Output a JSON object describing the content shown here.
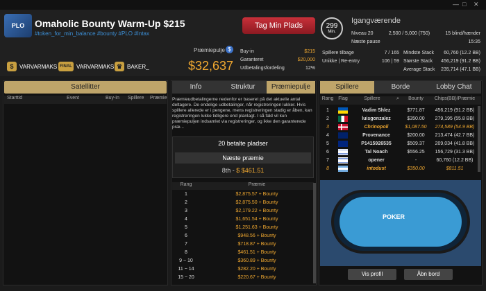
{
  "header": {
    "title": "Omaholic Bounty Warm-Up $215",
    "tags": "#token_for_min_balance #bounty #PLO #Intax",
    "bounties": [
      {
        "badge": "$",
        "name": "VARVARMAKS"
      },
      {
        "badge": "FINAL",
        "name": "VARVARMAKS"
      },
      {
        "badge": "trophy",
        "name": "BAKER_"
      }
    ]
  },
  "prize": {
    "label": "Præmiepulje",
    "value": "$32,637"
  },
  "buyin": [
    {
      "label": "Buy-in",
      "value": "$215"
    },
    {
      "label": "Garanteret",
      "value": "$20,000"
    },
    {
      "label": "Udbetalingsfordeling",
      "value": "12%"
    }
  ],
  "register_button": "Tag Min Plads",
  "clock": {
    "time": "299",
    "unit": "Min."
  },
  "status": "Igangværende",
  "level": [
    {
      "label": "Niveau 20",
      "value": "2,500 / 5,000 (750)",
      "extra": "15 blind/hænder"
    },
    {
      "label": "Næste pause",
      "value": "",
      "extra": "15:35"
    }
  ],
  "stats_left": [
    {
      "label": "Spillere tilbage",
      "value": "7 / 165"
    },
    {
      "label": "Unikke | Re-entry",
      "value": "106 | 59"
    }
  ],
  "stats_right": [
    {
      "label": "Mindste Stack",
      "value": "60,760 (12.2 BB)"
    },
    {
      "label": "Største Stack",
      "value": "456,219 (91.2 BB)"
    },
    {
      "label": "Average Stack",
      "value": "235,714 (47.1 BB)"
    }
  ],
  "satellites": {
    "button": "Satellitter",
    "columns": [
      "Starttid",
      "Event",
      "Buy-in",
      "Spillere",
      "Præmie"
    ]
  },
  "middle_tabs": [
    "Info",
    "Struktur",
    "Præmiepulje"
  ],
  "description": "Præmieudbetalingerne nedenfor er baseret på det aktuelle antal deltagere. De endelige udbetalinger, når registreringen lukker. Hvis spillere allerede er i pengene, mens registreringen stadig er åben, kan registreringen lukke tidligere end planlagt. I så fald vil kun præmiepuljen indsamlet via registreringer, og ikke den garanterede præ...",
  "paid_places": "20 betalte pladser",
  "next_prize": {
    "label": "Næste præmie",
    "place": "8th",
    "value": "$461.51"
  },
  "prize_columns": [
    "Rang",
    "Præmie"
  ],
  "prizes": [
    {
      "rank": "1",
      "prize": "$2,875.57 + Bounty"
    },
    {
      "rank": "2",
      "prize": "$2,875.50 + Bounty"
    },
    {
      "rank": "3",
      "prize": "$2,179.22 + Bounty"
    },
    {
      "rank": "4",
      "prize": "$1,651.54 + Bounty"
    },
    {
      "rank": "5",
      "prize": "$1,251.63 + Bounty"
    },
    {
      "rank": "6",
      "prize": "$948.56 + Bounty"
    },
    {
      "rank": "7",
      "prize": "$718.87 + Bounty"
    },
    {
      "rank": "8",
      "prize": "$461.51 + Bounty"
    },
    {
      "rank": "9 ~ 10",
      "prize": "$360.89 + Bounty"
    },
    {
      "rank": "11 ~ 14",
      "prize": "$282.20 + Bounty"
    },
    {
      "rank": "15 ~ 20",
      "prize": "$220.67 + Bounty"
    }
  ],
  "player_tabs": [
    "Spillere",
    "Borde",
    "Lobby Chat"
  ],
  "player_columns": [
    "Rang",
    "Flag",
    "Spillere",
    "Bounty",
    "Chips(BB)/Præmie"
  ],
  "players": [
    {
      "rank": "1",
      "flag": "UA",
      "name": "Vadim Shlez",
      "bounty": "$771.87",
      "chips": "456,219 (91.2 BB)",
      "hl": false
    },
    {
      "rank": "2",
      "flag": "MX",
      "name": "luisgonzalez",
      "bounty": "$350.00",
      "chips": "279,195 (55.8 BB)",
      "hl": false
    },
    {
      "rank": "3",
      "flag": "DK",
      "name": "Chrinopoli",
      "bounty": "$1,087.50",
      "chips": "274,589 (54.9 BB)",
      "hl": true
    },
    {
      "rank": "4",
      "flag": "AU",
      "name": "Provenance",
      "bounty": "$200.00",
      "chips": "213,474 (42.7 BB)",
      "hl": false
    },
    {
      "rank": "5",
      "flag": "NZ",
      "name": "P1415926535",
      "bounty": "$509.37",
      "chips": "209,034 (41.8 BB)",
      "hl": false
    },
    {
      "rank": "6",
      "flag": "IL",
      "name": "Tal Noach",
      "bounty": "$556.25",
      "chips": "156,729 (31.3 BB)",
      "hl": false
    },
    {
      "rank": "7",
      "flag": "IL",
      "name": "opener",
      "bounty": "-",
      "chips": "60,760 (12.2 BB)",
      "hl": false
    },
    {
      "rank": "8",
      "flag": "AR",
      "name": "intodust",
      "bounty": "$350.00",
      "chips": "$811.51",
      "hl": true
    }
  ],
  "table_logo": "POKER",
  "buttons": {
    "view_profile": "Vis profil",
    "open_table": "Åbn bord"
  },
  "colors": {
    "accent": "#bfa56a",
    "gold": "#f0a830",
    "register": "#c8303a"
  }
}
